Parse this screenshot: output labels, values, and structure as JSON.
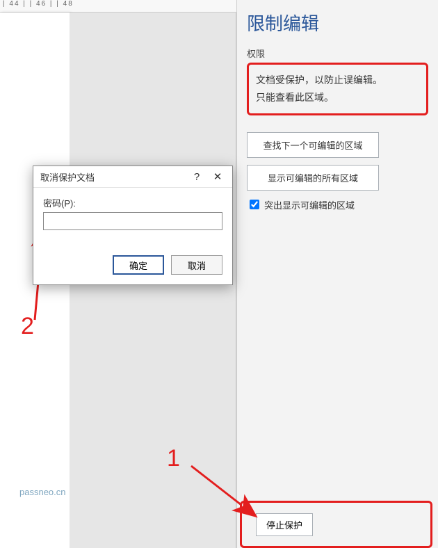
{
  "ruler": {
    "marks": "   | 44 |   | 46 |   | 48"
  },
  "panel": {
    "title": "限制编辑",
    "permissions_label": "权限",
    "note_line1": "文档受保护，以防止误编辑。",
    "note_line2": "只能查看此区域。",
    "find_next_btn": "查找下一个可编辑的区域",
    "show_all_btn": "显示可编辑的所有区域",
    "highlight_checkbox": "突出显示可编辑的区域",
    "stop_btn": "停止保护"
  },
  "dialog": {
    "title": "取消保护文档",
    "help_glyph": "?",
    "close_glyph": "✕",
    "password_label": "密码(P):",
    "password_value": "",
    "ok": "确定",
    "cancel": "取消"
  },
  "annotations": {
    "n1": "1",
    "n2": "2"
  },
  "watermark": "passneo.cn"
}
